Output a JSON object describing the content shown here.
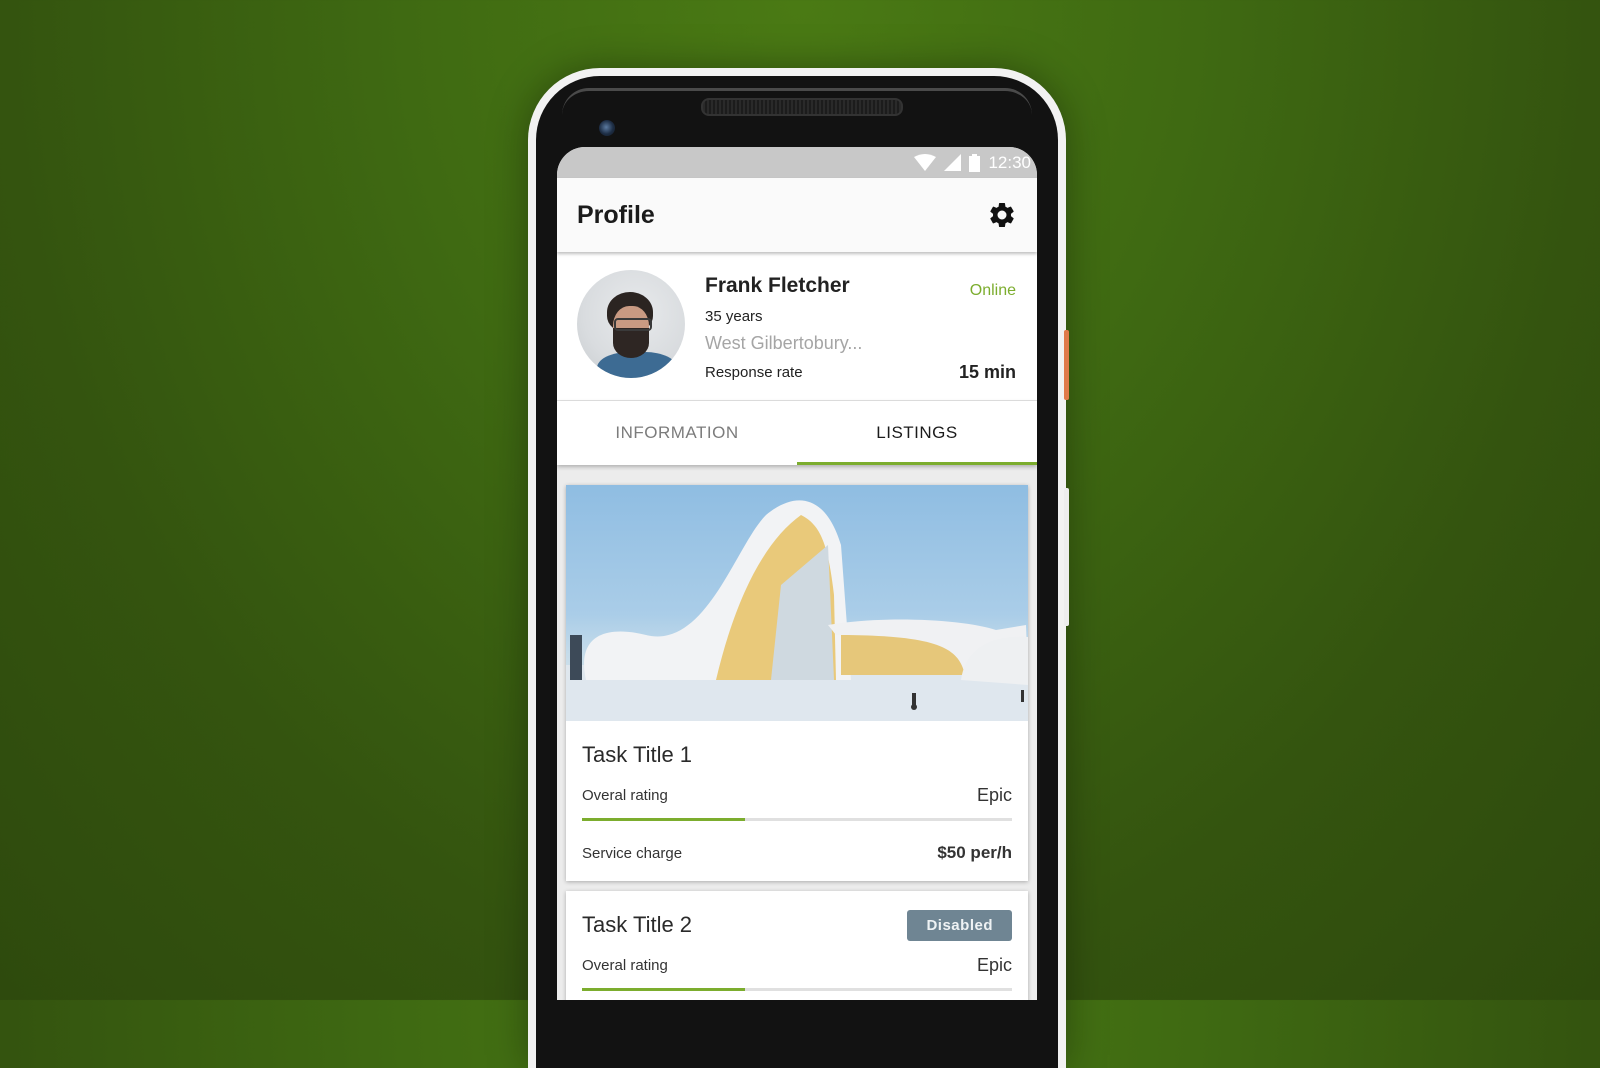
{
  "status_bar": {
    "time": "12:30",
    "icons": [
      "wifi-icon",
      "signal-icon",
      "battery-icon"
    ]
  },
  "app_bar": {
    "title": "Profile",
    "settings_icon": "gear-icon"
  },
  "profile": {
    "name": "Frank Fletcher",
    "age": "35 years",
    "location": "West Gilbertobury...",
    "status": "Online",
    "response_label": "Response rate",
    "response_value": "15 min"
  },
  "tabs": [
    {
      "label": "INFORMATION",
      "active": false
    },
    {
      "label": "LISTINGS",
      "active": true
    }
  ],
  "listings": [
    {
      "title": "Task Title 1",
      "has_image": true,
      "rating_label": "Overal rating",
      "rating_value": "Epic",
      "rating_progress": 0.38,
      "charge_label": "Service charge",
      "charge_value": "$50 per/h"
    },
    {
      "title": "Task Title 2",
      "badge": "Disabled",
      "rating_label": "Overal rating",
      "rating_value": "Epic",
      "rating_progress": 0.38
    }
  ],
  "colors": {
    "accent": "#7cad2e",
    "badge": "#6f8593",
    "background": "#3f6a12"
  }
}
